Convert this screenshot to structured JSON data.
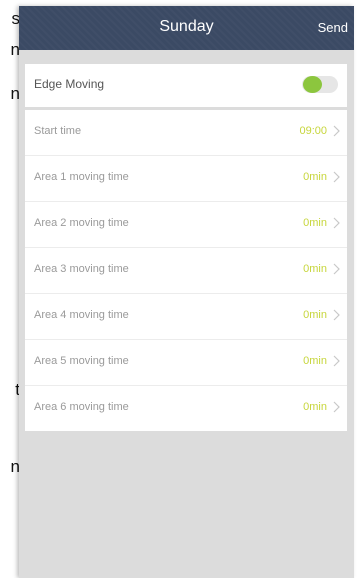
{
  "background_fragments": [
    "s",
    "n",
    "n",
    "t",
    "n"
  ],
  "navbar": {
    "title": "Sunday",
    "send_label": "Send"
  },
  "edge_moving": {
    "label": "Edge Moving",
    "enabled": true,
    "accent": "#8cc63e"
  },
  "rows": [
    {
      "label": "Start time",
      "value": "09:00"
    },
    {
      "label": "Area 1 moving time",
      "value": "0min"
    },
    {
      "label": "Area 2 moving time",
      "value": "0min"
    },
    {
      "label": "Area 3 moving time",
      "value": "0min"
    },
    {
      "label": "Area 4 moving time",
      "value": "0min"
    },
    {
      "label": "Area 5 moving time",
      "value": "0min"
    },
    {
      "label": "Area 6 moving time",
      "value": "0min"
    }
  ],
  "colors": {
    "navbar": "#3b4a64",
    "value": "#c7d63c",
    "background": "#dcdcdc"
  },
  "icons": {
    "row_chevron": "chevron-right-icon"
  }
}
